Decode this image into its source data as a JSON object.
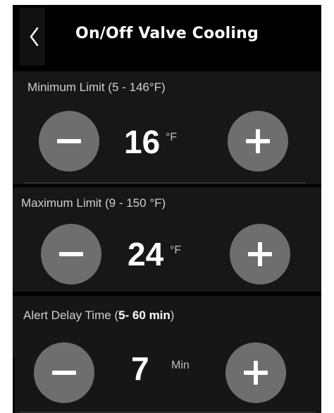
{
  "header": {
    "title": "On/Off Valve Cooling",
    "back_icon": "chevron-left-icon"
  },
  "minimum_limit": {
    "label": "Minimum Limit (5 - 146°F)",
    "value": "16",
    "unit": "°F",
    "decrement_icon": "minus-icon",
    "increment_icon": "plus-icon"
  },
  "maximum_limit": {
    "label": "Maximum Limit (9 - 150 °F)",
    "value": "24",
    "unit": "°F",
    "decrement_icon": "minus-icon",
    "increment_icon": "plus-icon"
  },
  "alert_delay": {
    "label_prefix": "Alert Delay Time (",
    "label_range": "5- 60 min",
    "label_suffix": ")",
    "value": "7",
    "unit": "Min",
    "decrement_icon": "minus-icon",
    "increment_icon": "plus-icon"
  },
  "colors": {
    "background": "#000000",
    "section": "#171717",
    "button": "#6e6e6e",
    "text": "#ffffff",
    "label": "#cfcfcf"
  }
}
